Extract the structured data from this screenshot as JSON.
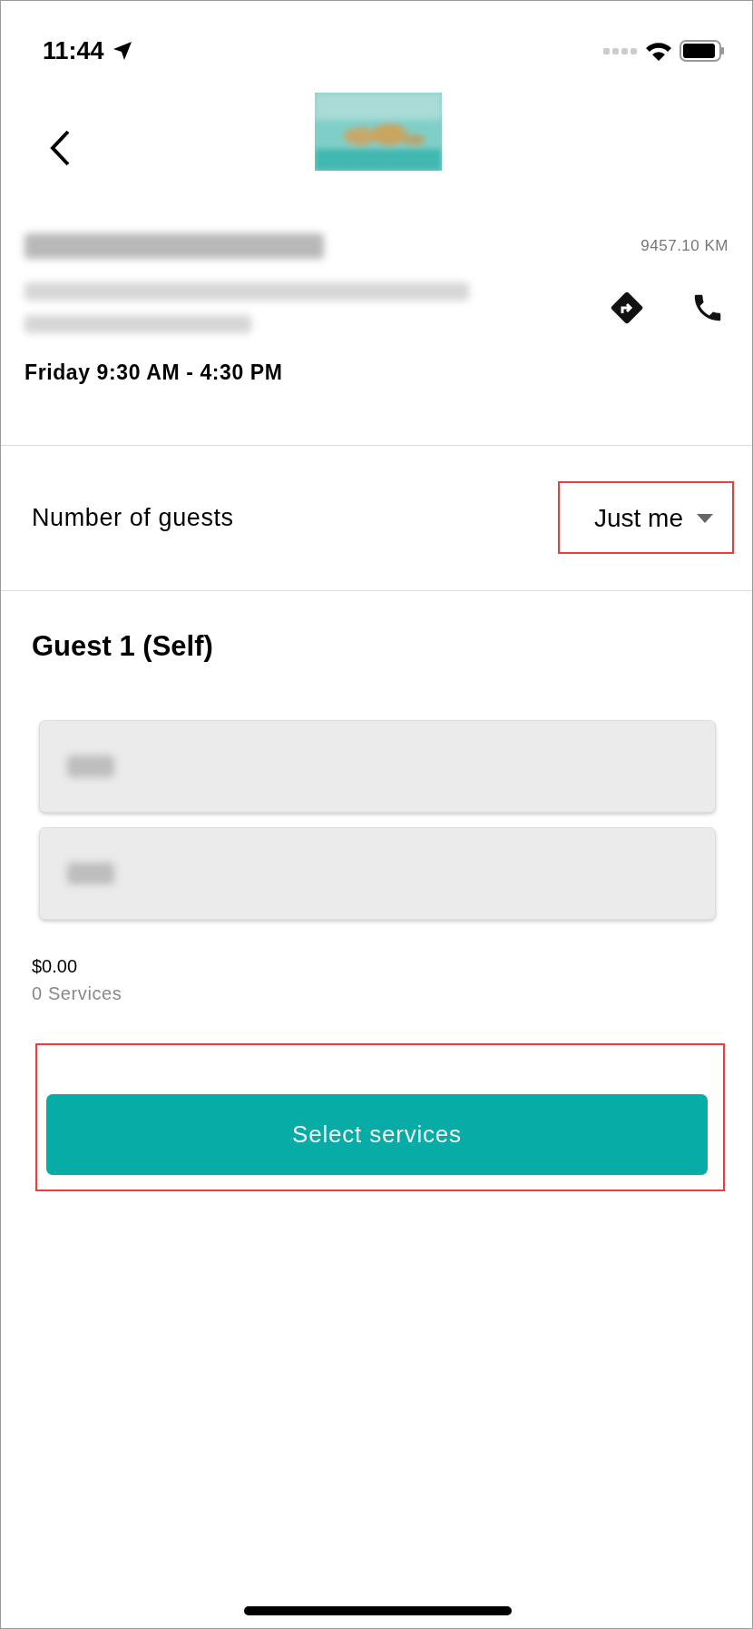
{
  "status_bar": {
    "time": "11:44",
    "location_active": true
  },
  "store": {
    "name_redacted": true,
    "address_redacted": true,
    "distance": "9457.10 KM",
    "hours": "Friday 9:30 AM - 4:30 PM"
  },
  "guests": {
    "label": "Number of guests",
    "value": "Just me",
    "highlighted": true
  },
  "guest": {
    "title": "Guest 1 (Self)",
    "fields": [
      {
        "redacted": true
      },
      {
        "redacted": true
      }
    ],
    "price": "$0.00",
    "services": "0 Services"
  },
  "action": {
    "label": "Select services",
    "highlighted": true
  }
}
